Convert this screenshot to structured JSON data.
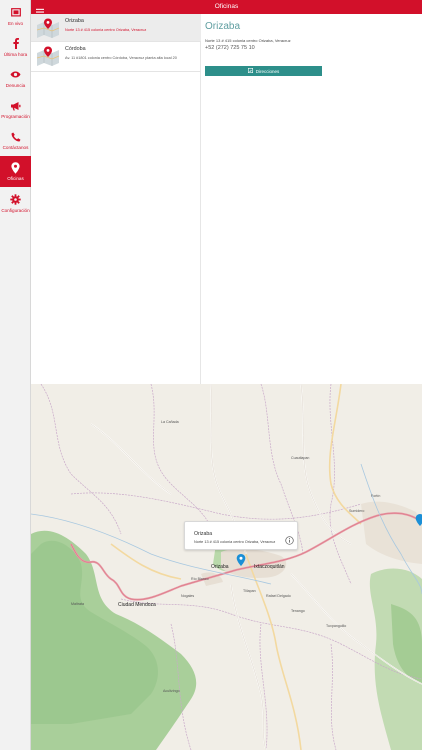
{
  "header": {
    "title": "Oficinas"
  },
  "sidebar": {
    "items": [
      {
        "label": "En vivo",
        "icon": "live-tv-icon"
      },
      {
        "label": "Última hora",
        "icon": "facebook-icon"
      },
      {
        "label": "Denuncia",
        "icon": "eye-icon"
      },
      {
        "label": "Programación",
        "icon": "megaphone-icon"
      },
      {
        "label": "Contáctanos",
        "icon": "phone-icon"
      },
      {
        "label": "Oficinas",
        "icon": "location-pin-icon"
      },
      {
        "label": "Configuración",
        "icon": "gear-icon"
      }
    ],
    "active": "Oficinas"
  },
  "offices": [
    {
      "name": "Orizaba",
      "address": "Norte 13 # 415 colonia centro Orizaba, Veracruz"
    },
    {
      "name": "Córdoba",
      "address": "Av. 11 #1801 colonia centro Córdoba, Veracruz planta alta local 20"
    }
  ],
  "detail": {
    "name": "Orizaba",
    "address": "Norte 13 # 415 colonia centro Orizaba, Veracruz",
    "phone": "+52 (272) 725 75 10",
    "directions_label": "Direcciones"
  },
  "map": {
    "popup": {
      "name": "Orizaba",
      "address": "Norte 13 # 415 colonia centro Orizaba, Veracruz"
    },
    "labels": {
      "l0": "Ixtaczoquitlán",
      "l1": "Orizaba",
      "l2": "Río Blanco",
      "l3": "Ciudad Mendoza",
      "l4": "Nogales",
      "l5": "Fortín",
      "l6": "Sumidero",
      "l7": "Tlilapan",
      "l8": "Acultzingo",
      "l9": "Maltrata",
      "l10": "La Cañada",
      "l11": "Tuxpanguillo",
      "l12": "Cuautlapan",
      "l13": "Tenango",
      "l14": "Rafael Delgado"
    }
  },
  "colors": {
    "brand": "#d2102a",
    "accent": "#2d8f8a",
    "title": "#5f9ea0"
  }
}
